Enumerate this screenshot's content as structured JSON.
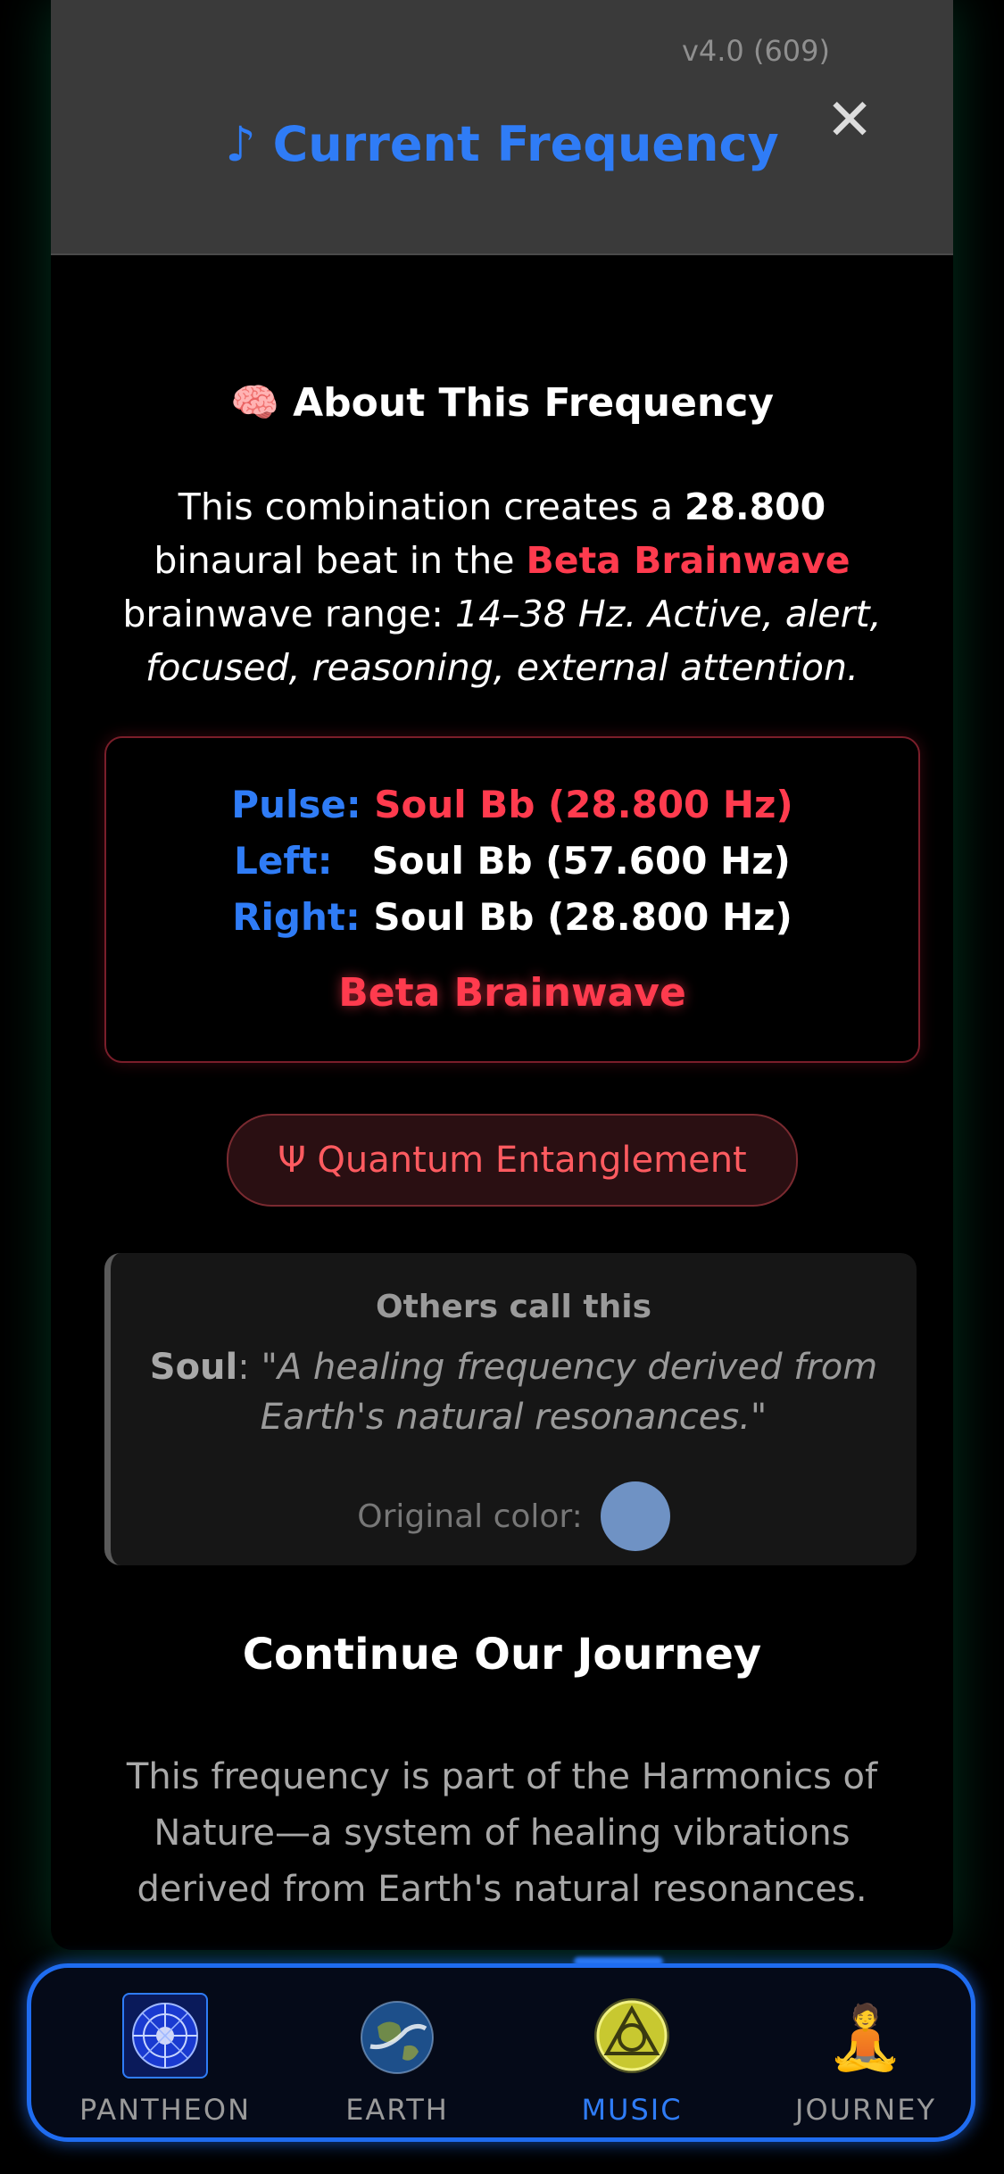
{
  "header": {
    "version": "v4.0 (609)",
    "title": "♪ Current Frequency",
    "close_label": "✕"
  },
  "about": {
    "heading": "🧠 About This Frequency",
    "text_prefix": "This combination creates a ",
    "beat_value": "28.800",
    "text_mid": " binaural beat in the ",
    "brainwave_name": "Beta Brainwave",
    "text_range_prefix": " brainwave range: ",
    "range_description": "14–38 Hz. Active, alert, focused, reasoning, external attention."
  },
  "frequency_box": {
    "pulse_label": "Pulse:",
    "pulse_value": "Soul Bb (28.800 Hz)",
    "left_label": "Left:",
    "left_value": "Soul Bb (57.600 Hz)",
    "right_label": "Right:",
    "right_value": "Soul Bb (28.800 Hz)",
    "brainwave": "Beta Brainwave"
  },
  "entangle_button": {
    "label": "Ψ Quantum Entanglement"
  },
  "others": {
    "title": "Others call this",
    "source": "Soul",
    "quote": "\"A healing frequency derived from Earth's natural resonances.\"",
    "original_color_label": "Original color:",
    "original_color": "#6f92c4"
  },
  "journey": {
    "heading": "Continue Our Journey",
    "text": "This frequency is part of the Harmonics of Nature—a system of healing vibrations derived from Earth's natural resonances."
  },
  "nav": {
    "items": [
      {
        "label": "PANTHEON",
        "icon": "pantheon-icon"
      },
      {
        "label": "EARTH",
        "icon": "earth-icon"
      },
      {
        "label": "MUSIC",
        "icon": "music-icon"
      },
      {
        "label": "JOURNEY",
        "icon": "journey-icon"
      }
    ],
    "active_index": 2,
    "accent_color": "#2f7cf6",
    "journey_glyph": "🧘"
  }
}
